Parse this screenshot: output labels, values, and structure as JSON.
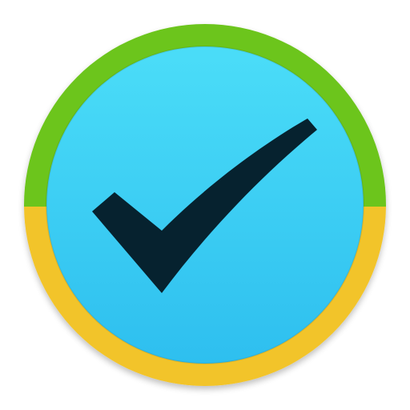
{
  "icon": {
    "name": "checkmark-app-icon",
    "glyph": "check-icon",
    "colors": {
      "ring_top": "#6CC51F",
      "ring_bottom": "#F2C42A",
      "disc_light": "#4BDDF8",
      "disc_dark": "#2EBFEF",
      "check": "#06222F",
      "background": "#FFFFFF"
    }
  }
}
